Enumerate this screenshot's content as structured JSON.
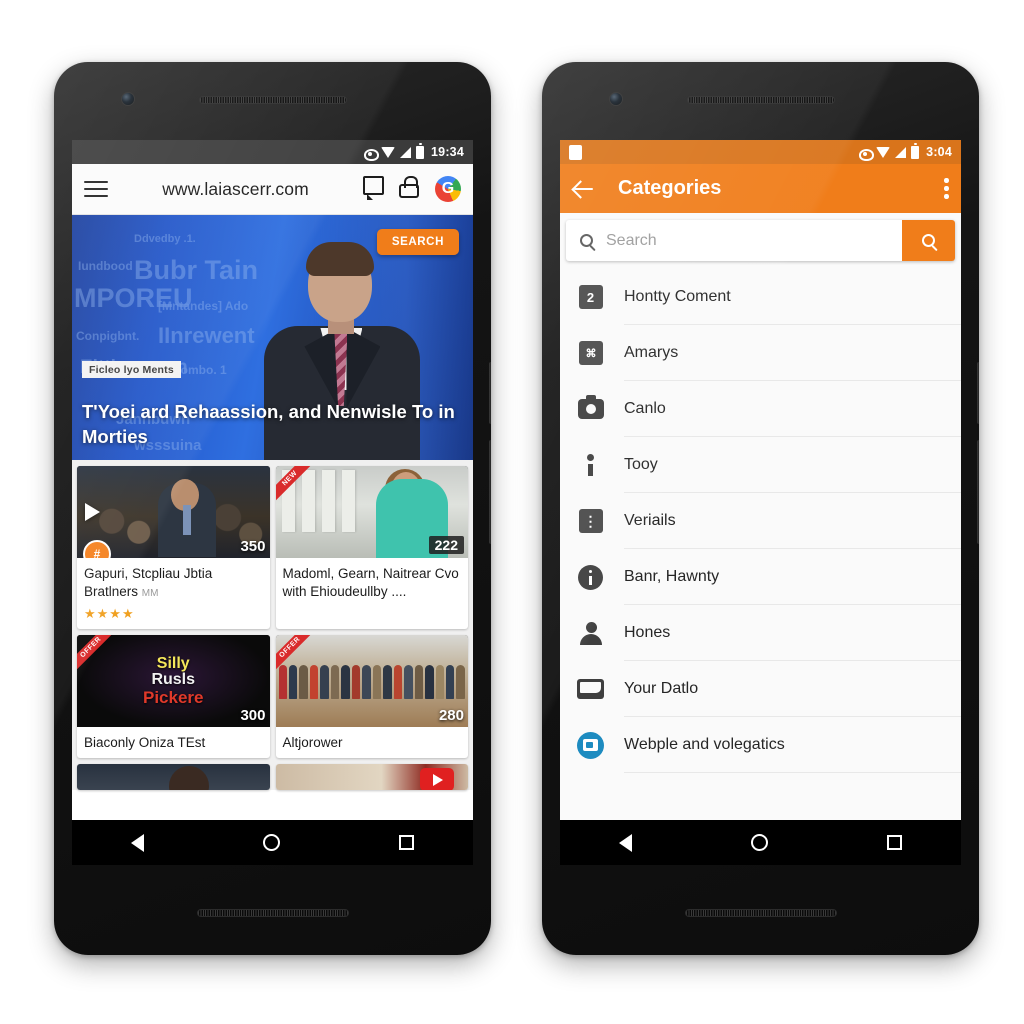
{
  "left_phone": {
    "status_bar": {
      "time": "19:34",
      "icons": [
        "wifi-alt-icon",
        "wifi-icon",
        "signal-icon",
        "battery-icon"
      ]
    },
    "browser": {
      "menu_icon": "hamburger-icon",
      "url": "www.laiascerr.com",
      "icons": [
        "tab-switcher-icon",
        "lock-icon",
        "google-icon"
      ]
    },
    "hero": {
      "search_button": "SEARCH",
      "kicker": "Ficleo lyo Ments",
      "title": "T'Yoei ard Rehaassion, and Nenwisle To in Morties",
      "backdrop_words": [
        "Ddvedby .1.",
        "Bubr Tain",
        "MPOREU",
        "Iundbood",
        "[Mntandes] Ado",
        "Conpigbnt.",
        "IInrewent",
        "Eltties worn",
        "Combo. 1",
        "Janhbuwn",
        "wsssuina"
      ]
    },
    "cards": [
      {
        "title": "Gapuri, Stcpliau Jbtia Bratlners",
        "subtitle": "MM",
        "duration": "350",
        "badge": "#",
        "ribbon": "",
        "stars": "★★★★",
        "thumb": "crowd",
        "play": true
      },
      {
        "title": "Madoml, Gearn, Naitrear Cvo with Ehioudeullby ....",
        "subtitle": "",
        "duration": "222",
        "badge": "",
        "ribbon": "NEW",
        "stars": "",
        "thumb": "white-house",
        "play": false
      },
      {
        "title": "Biaconly Oniza TEst",
        "subtitle": "",
        "duration": "300",
        "badge": "",
        "ribbon": "OFFER",
        "stars": "",
        "thumb": "dark-logo",
        "play": false,
        "logo": [
          "Silly",
          "Rusls",
          "Pickere"
        ]
      },
      {
        "title": "Altjorower",
        "subtitle": "",
        "duration": "280",
        "badge": "",
        "ribbon": "OFFER",
        "stars": "",
        "thumb": "rally",
        "play": false
      }
    ],
    "nav": [
      "back-icon",
      "home-icon",
      "recents-icon"
    ]
  },
  "right_phone": {
    "status_bar": {
      "time": "3:04",
      "left_icon": "clipboard-icon",
      "icons": [
        "wifi-alt-icon",
        "wifi-icon",
        "signal-icon",
        "battery-icon"
      ]
    },
    "appbar": {
      "back": "back-arrow-icon",
      "title": "Categories",
      "overflow": "kebab-menu-icon"
    },
    "search": {
      "placeholder": "Search",
      "value": "",
      "button_icon": "search-icon"
    },
    "categories": [
      {
        "label": "Hontty Coment",
        "icon": "number-badge-icon",
        "glyph": "2"
      },
      {
        "label": "Amarys",
        "icon": "command-badge-icon",
        "glyph": "⌘"
      },
      {
        "label": "Canlo",
        "icon": "camera-icon",
        "glyph": ""
      },
      {
        "label": "Tooy",
        "icon": "info-icon",
        "glyph": ""
      },
      {
        "label": "Veriails",
        "icon": "more-badge-icon",
        "glyph": "⋮"
      },
      {
        "label": "Banr, Hawnty",
        "icon": "info-circle-icon",
        "glyph": ""
      },
      {
        "label": "Hones",
        "icon": "person-icon",
        "glyph": ""
      },
      {
        "label": "Your Datlo",
        "icon": "folder-icon",
        "glyph": ""
      },
      {
        "label": "Webple and volegatics",
        "icon": "device-circle-icon",
        "glyph": ""
      }
    ],
    "nav": [
      "back-icon",
      "home-icon",
      "recents-icon"
    ]
  },
  "colors": {
    "accent_orange": "#f07d1a",
    "status_orange": "#d9741b",
    "status_dark": "#3b3b3b",
    "hero_blue": "#2256c9",
    "list_bg": "#fafafa",
    "icon_gray": "#3f3f3f",
    "blue_circle": "#1d8bc0",
    "ribbon_red": "#d92b2b",
    "star_gold": "#f0a020"
  }
}
